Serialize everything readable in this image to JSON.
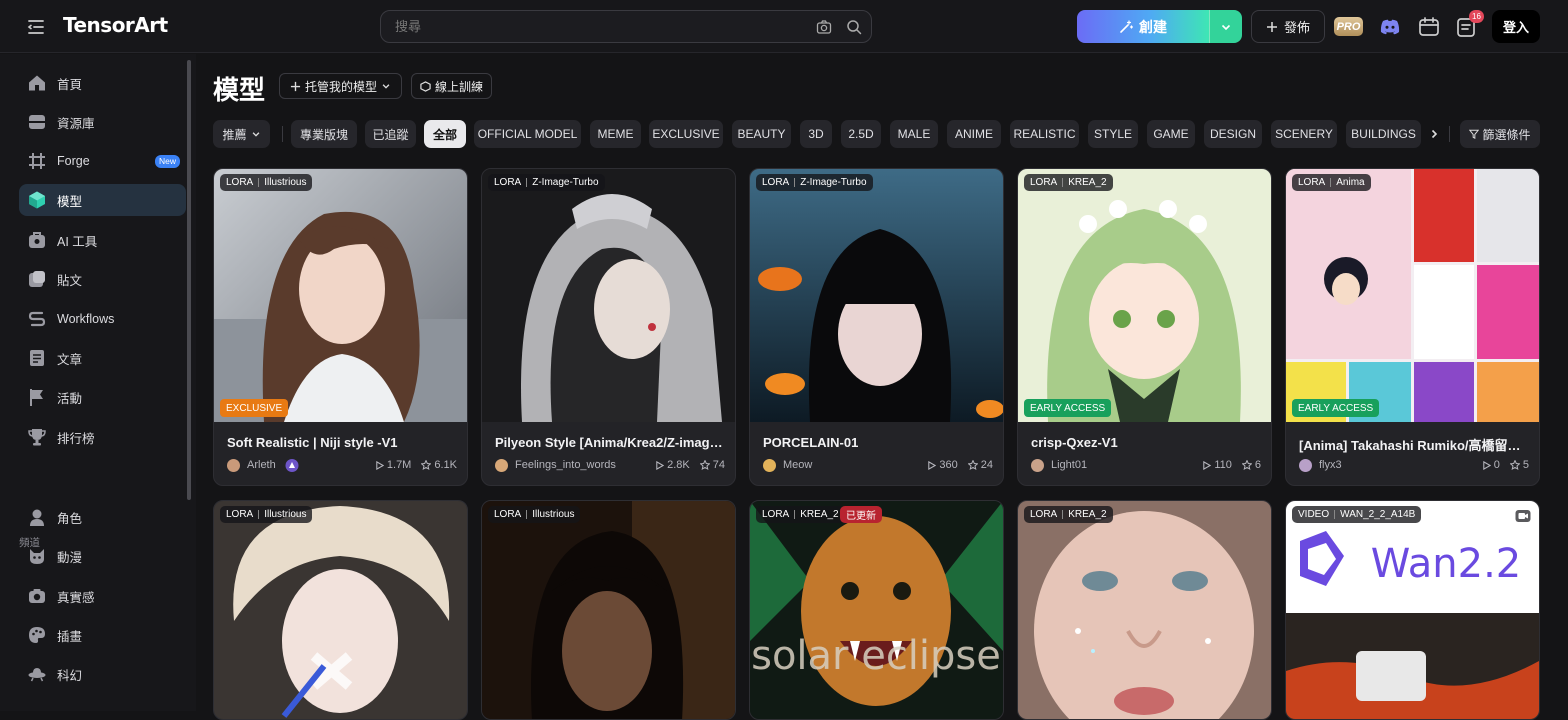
{
  "app": {
    "logo_text": "TensorArt"
  },
  "header": {
    "search_placeholder": "搜尋",
    "create_label": "創建",
    "publish_label": "發佈",
    "pro_label": "PRO",
    "notification_count": "16",
    "login_label": "登入"
  },
  "sidebar": {
    "items": [
      {
        "label": "首頁",
        "icon": "home-icon"
      },
      {
        "label": "資源庫",
        "icon": "library-icon"
      },
      {
        "label": "Forge",
        "icon": "forge-icon",
        "badge": "New"
      },
      {
        "label": "模型",
        "icon": "model-icon",
        "active": true
      },
      {
        "label": "AI 工具",
        "icon": "ai-tools-icon"
      },
      {
        "label": "貼文",
        "icon": "posts-icon"
      },
      {
        "label": "Workflows",
        "icon": "workflows-icon"
      },
      {
        "label": "文章",
        "icon": "articles-icon"
      },
      {
        "label": "活動",
        "icon": "events-flag-icon"
      },
      {
        "label": "排行榜",
        "icon": "trophy-icon"
      }
    ],
    "section_label": "頻道",
    "channels": [
      {
        "label": "角色",
        "icon": "character-icon"
      },
      {
        "label": "動漫",
        "icon": "anime-icon"
      },
      {
        "label": "真實感",
        "icon": "camera-icon"
      },
      {
        "label": "插畫",
        "icon": "palette-icon"
      },
      {
        "label": "科幻",
        "icon": "ufo-icon"
      }
    ]
  },
  "main": {
    "title": "模型",
    "hosted_label": "托管我的模型",
    "train_label": "線上訓練",
    "sort_label": "推薦",
    "filter_label": "篩選條件",
    "chips": [
      "專業版塊",
      "已追蹤",
      "全部",
      "OFFICIAL MODEL",
      "MEME",
      "EXCLUSIVE",
      "BEAUTY",
      "3D",
      "2.5D",
      "MALE",
      "ANIME",
      "REALISTIC",
      "STYLE",
      "GAME",
      "DESIGN",
      "SCENERY",
      "BUILDINGS"
    ],
    "selected_chip": "全部"
  },
  "cards": [
    {
      "type": "LORA",
      "base": "Illustrious",
      "title": "Soft Realistic | Niji style -V1",
      "author": "Arleth",
      "runs": "1.7M",
      "stars": "6.1K",
      "badge": "EXCLUSIVE",
      "badge_color": "#e87a13"
    },
    {
      "type": "LORA",
      "base": "Z-Image-Turbo",
      "title": "Pilyeon Style [Anima/Krea2/Z-image...",
      "author": "Feelings_into_words",
      "runs": "2.8K",
      "stars": "74"
    },
    {
      "type": "LORA",
      "base": "Z-Image-Turbo",
      "title": "PORCELAIN-01",
      "author": "Meow",
      "runs": "360",
      "stars": "24"
    },
    {
      "type": "LORA",
      "base": "KREA_2",
      "title": "crisp-Qxez-V1",
      "author": "Light01",
      "runs": "110",
      "stars": "6",
      "badge": "EARLY ACCESS",
      "badge_color": "#18a05c"
    },
    {
      "type": "LORA",
      "base": "Anima",
      "title": "[Anima] Takahashi Rumiko/高橋留美...",
      "author": "flyx3",
      "runs": "0",
      "stars": "5",
      "badge": "EARLY ACCESS",
      "badge_color": "#18a05c"
    },
    {
      "type": "LORA",
      "base": "Illustrious"
    },
    {
      "type": "LORA",
      "base": "Illustrious"
    },
    {
      "type": "LORA",
      "base": "KREA_2",
      "update": "已更新",
      "overlay_text": "solar eclipse"
    },
    {
      "type": "LORA",
      "base": "KREA_2"
    },
    {
      "type": "VIDEO",
      "base": "WAN_2_2_A14B",
      "overlay_text": "Wan2.2"
    }
  ]
}
